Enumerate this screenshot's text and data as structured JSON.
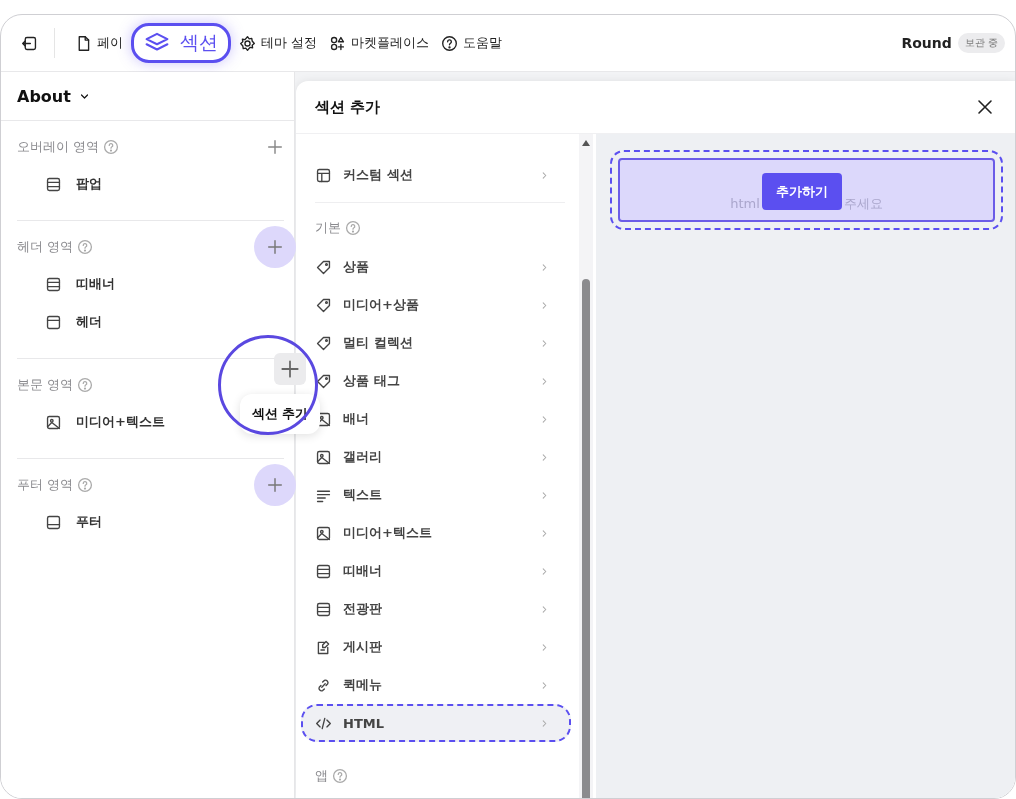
{
  "topbar": {
    "nav": [
      {
        "label": "페이",
        "kind": "page",
        "highlighted": false
      },
      {
        "label": "섹션",
        "kind": "layers",
        "highlighted": true
      },
      {
        "label": "테마 설정",
        "kind": "gear",
        "highlighted": false
      },
      {
        "label": "마켓플레이스",
        "kind": "apps",
        "highlighted": false
      },
      {
        "label": "도움말",
        "kind": "help",
        "highlighted": false
      }
    ],
    "store": "Round",
    "badge": "보관 중"
  },
  "sidebar": {
    "page": "About",
    "groups": [
      {
        "title": "오버레이 영역",
        "kind": "plain",
        "circled": false,
        "items": [
          {
            "label": "팝업",
            "kind": "banner"
          }
        ]
      },
      {
        "title": "헤더 영역",
        "kind": "accent",
        "circled": false,
        "items": [
          {
            "label": "띠배너",
            "kind": "banner"
          },
          {
            "label": "헤더",
            "kind": "header"
          }
        ]
      },
      {
        "title": "본문 영역",
        "kind": "hover",
        "circled": true,
        "tooltip": "섹션 추가",
        "items": [
          {
            "label": "미디어+텍스트",
            "kind": "image"
          }
        ]
      },
      {
        "title": "푸터 영역",
        "kind": "accent",
        "circled": false,
        "items": [
          {
            "label": "푸터",
            "kind": "footer"
          }
        ]
      }
    ]
  },
  "modal": {
    "title": "섹션 추가",
    "groups": [
      {
        "items": [
          {
            "label": "커스텀 섹션",
            "kind": "layout",
            "highlighted": false
          }
        ]
      },
      {
        "title": "기본",
        "items": [
          {
            "label": "상품",
            "kind": "tag",
            "highlighted": false
          },
          {
            "label": "미디어+상품",
            "kind": "tag",
            "highlighted": false
          },
          {
            "label": "멀티 컬렉션",
            "kind": "tag",
            "highlighted": false
          },
          {
            "label": "상품 태그",
            "kind": "tag",
            "highlighted": false
          },
          {
            "label": "배너",
            "kind": "image",
            "highlighted": false
          },
          {
            "label": "갤러리",
            "kind": "image",
            "highlighted": false
          },
          {
            "label": "텍스트",
            "kind": "lines",
            "highlighted": false
          },
          {
            "label": "미디어+텍스트",
            "kind": "image",
            "highlighted": false
          },
          {
            "label": "띠배너",
            "kind": "banner",
            "highlighted": false
          },
          {
            "label": "전광판",
            "kind": "banner",
            "highlighted": false
          },
          {
            "label": "게시판",
            "kind": "board",
            "highlighted": false
          },
          {
            "label": "퀵메뉴",
            "kind": "link",
            "highlighted": false
          },
          {
            "label": "HTML",
            "kind": "code",
            "highlighted": true
          }
        ]
      },
      {
        "title": "앱"
      }
    ],
    "preview": {
      "hint_parts": [
        "html",
        "주세요"
      ],
      "button": "추가하기",
      "highlighted": true
    }
  }
}
